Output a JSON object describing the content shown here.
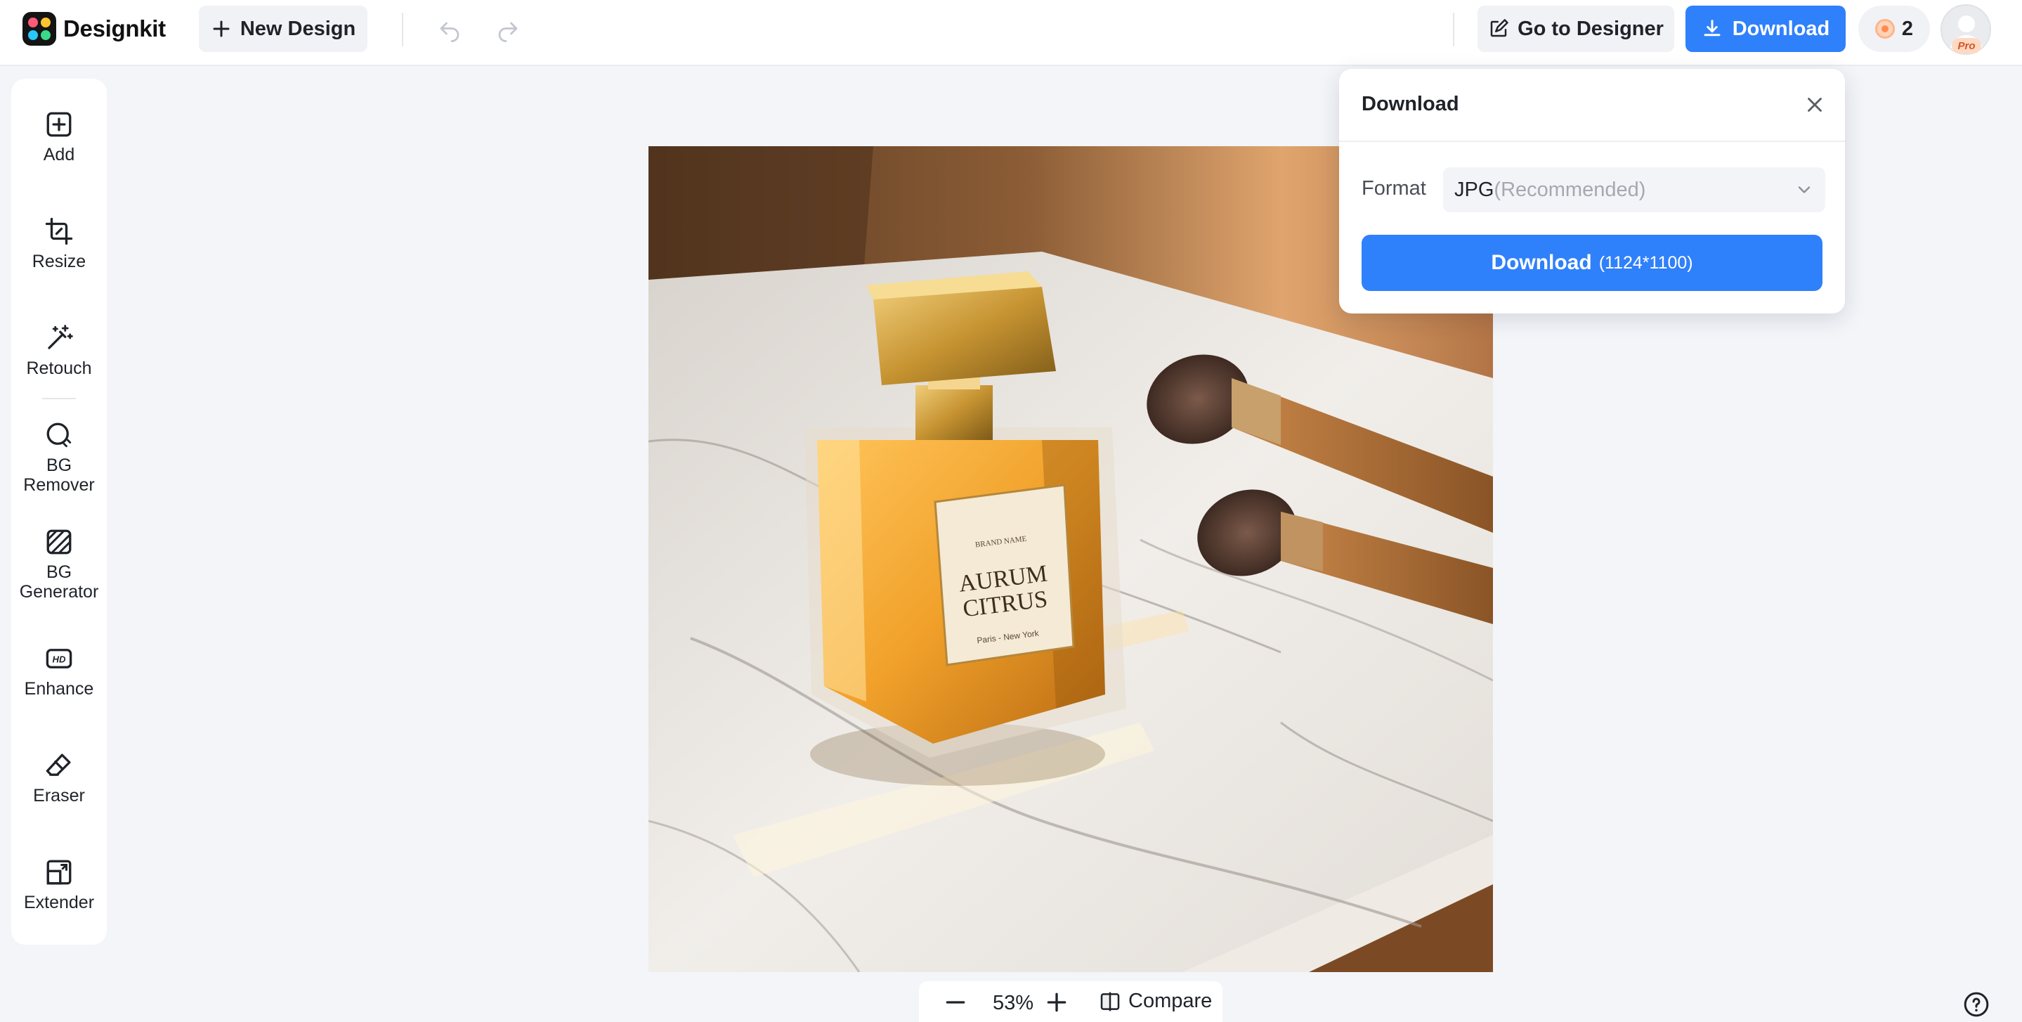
{
  "app": {
    "brand_name": "Designkit"
  },
  "toolbar": {
    "new_design_label": "New Design",
    "go_to_designer_label": "Go to Designer",
    "download_label": "Download",
    "credits_count": "2",
    "pro_badge": "Pro"
  },
  "sidebar": {
    "items": [
      {
        "label": "Add",
        "icon": "add-icon"
      },
      {
        "label": "Resize",
        "icon": "crop-icon"
      },
      {
        "label": "Retouch",
        "icon": "magic-wand-icon"
      },
      {
        "label": "BG Remover",
        "icon": "bg-remover-icon"
      },
      {
        "label": "BG Generator",
        "icon": "bg-generator-icon"
      },
      {
        "label": "Enhance",
        "icon": "hd-icon"
      },
      {
        "label": "Eraser",
        "icon": "eraser-icon"
      },
      {
        "label": "Extender",
        "icon": "extender-icon"
      }
    ]
  },
  "canvas": {
    "label_brand": "BRAND NAME",
    "label_line1": "AURUM",
    "label_line2": "CITRUS",
    "label_sub": "Paris - New York"
  },
  "download_panel": {
    "title": "Download",
    "format_label": "Format",
    "format_value": "JPG",
    "format_hint": "(Recommended)",
    "button_label": "Download",
    "button_resolution": "(1124*1100)"
  },
  "zoom": {
    "value": "53%",
    "compare_label": "Compare"
  },
  "colors": {
    "accent": "#2f80fb",
    "background": "#f3f5f9"
  }
}
